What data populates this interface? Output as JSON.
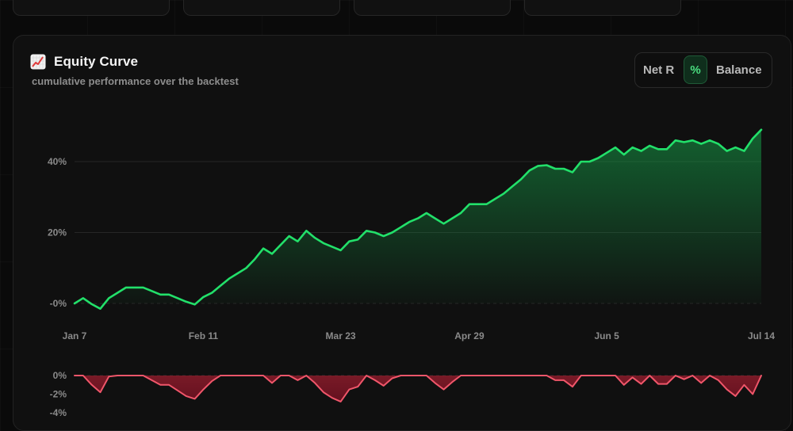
{
  "top_cards": [
    "",
    "",
    "",
    ""
  ],
  "equity_card": {
    "title": "Equity Curve",
    "title_icon": "chart-increasing-icon",
    "subtitle": "cumulative performance over the backtest"
  },
  "toggle": {
    "options": [
      "Net R",
      "%",
      "Balance"
    ],
    "selected": "%"
  },
  "colors": {
    "positive": "#22e06a",
    "negative": "#f0566a",
    "grid": "#262626"
  },
  "chart_data": [
    {
      "type": "area",
      "title": "",
      "xlabel": "",
      "ylabel": "",
      "x_tick_labels": [
        "Jan 7",
        "Feb 11",
        "Mar 23",
        "Apr 29",
        "Jun 5",
        "Jul 14"
      ],
      "y_tick_labels": [
        "-0%",
        "20%",
        "40%"
      ],
      "y_ticks": [
        0,
        20,
        40
      ],
      "ylim": [
        -4,
        52
      ],
      "grid": true,
      "series": [
        {
          "values": [
            0.0,
            1.5,
            -0.2,
            -1.5,
            1.5,
            3.0,
            4.5,
            4.5,
            4.5,
            3.5,
            2.5,
            2.5,
            1.5,
            0.5,
            -0.3,
            1.8,
            3.0,
            5.0,
            7.0,
            8.5,
            10.0,
            12.5,
            15.5,
            14.0,
            16.5,
            19.0,
            17.5,
            20.5,
            18.5,
            17.0,
            16.0,
            15.0,
            17.5,
            18.0,
            20.5,
            20.0,
            19.0,
            20.0,
            21.5,
            23.0,
            24.0,
            25.5,
            24.0,
            22.5,
            24.0,
            25.5,
            28.0,
            28.0,
            28.0,
            29.5,
            31.0,
            33.0,
            35.0,
            37.5,
            38.8,
            39.0,
            38.0,
            38.0,
            37.0,
            40.0,
            40.0,
            41.0,
            42.5,
            44.0,
            42.0,
            44.0,
            43.0,
            44.5,
            43.5,
            43.5,
            46.0,
            45.5,
            46.0,
            45.0,
            46.0,
            45.0,
            43.0,
            44.0,
            43.0,
            46.5,
            49.0
          ]
        }
      ]
    },
    {
      "type": "area",
      "title": "",
      "xlabel": "",
      "ylabel": "",
      "y_tick_labels": [
        "0%",
        "-2%",
        "-4%"
      ],
      "y_ticks": [
        0,
        -2,
        -4
      ],
      "ylim": [
        -5.5,
        0
      ],
      "grid": true,
      "series": [
        {
          "values": [
            0.0,
            0.0,
            -1.0,
            -1.8,
            -0.1,
            0.0,
            0.0,
            0.0,
            0.0,
            -0.5,
            -1.0,
            -1.0,
            -1.6,
            -2.2,
            -2.5,
            -1.5,
            -0.6,
            0.0,
            0.0,
            0.0,
            0.0,
            0.0,
            0.0,
            -0.8,
            0.0,
            0.0,
            -0.5,
            0.0,
            -0.8,
            -1.8,
            -2.4,
            -2.8,
            -1.5,
            -1.2,
            0.0,
            -0.5,
            -1.1,
            -0.3,
            0.0,
            0.0,
            0.0,
            0.0,
            -0.8,
            -1.5,
            -0.7,
            0.0,
            0.0,
            0.0,
            0.0,
            0.0,
            0.0,
            0.0,
            0.0,
            0.0,
            0.0,
            0.0,
            -0.5,
            -0.5,
            -1.2,
            0.0,
            0.0,
            0.0,
            0.0,
            0.0,
            -1.0,
            -0.2,
            -0.9,
            0.0,
            -0.9,
            -0.9,
            0.0,
            -0.4,
            0.0,
            -0.8,
            0.0,
            -0.5,
            -1.5,
            -2.2,
            -1.0,
            -2.0,
            0.0
          ]
        }
      ]
    }
  ]
}
